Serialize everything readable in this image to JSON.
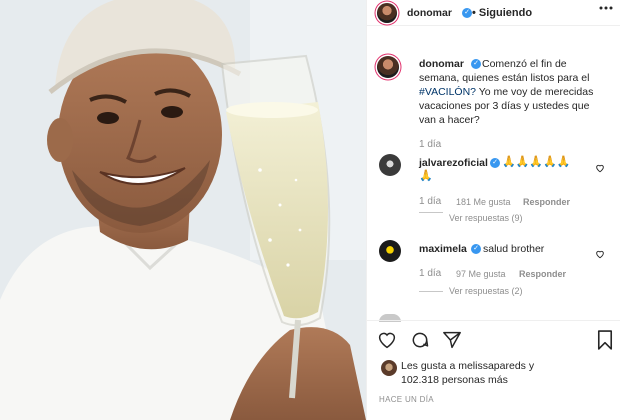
{
  "post": {
    "author": "donomar",
    "follow_status": "• Siguiendo",
    "caption_line1": "Comenzó el fin de",
    "caption_line2": "semana, quienes están listos para el",
    "caption_hashtag": "#VACILÓN?",
    "caption_line3_rest": " Yo me voy de merecidas",
    "caption_line4": "vacaciones por 3 días y ustedes que",
    "caption_line5": "van a hacer?",
    "caption_time": "1 día"
  },
  "comments": [
    {
      "user": "jalvarezoficial",
      "text": "🙏🙏🙏🙏🙏",
      "text_cont": "🙏",
      "time": "1 día",
      "likes": "181 Me gusta",
      "reply": "Responder",
      "view_replies": "Ver respuestas (9)"
    },
    {
      "user": "maximela",
      "text": "salud brother",
      "time": "1 día",
      "likes": "97 Me gusta",
      "reply": "Responder",
      "view_replies": "Ver respuestas (2)"
    }
  ],
  "likes": {
    "line1": "Les gusta a melissapareds y",
    "line2": "102.318 personas más"
  },
  "timestamp": "HACE UN DÍA",
  "icons": {
    "more": "more-horiz-icon",
    "like": "heart-icon",
    "comment": "comment-icon",
    "share": "share-icon",
    "save": "bookmark-icon",
    "verified": "verified-icon"
  },
  "colors": {
    "verified": "#3897f0",
    "text": "#262626",
    "muted": "#8e8e8e",
    "hashtag": "#003569"
  }
}
